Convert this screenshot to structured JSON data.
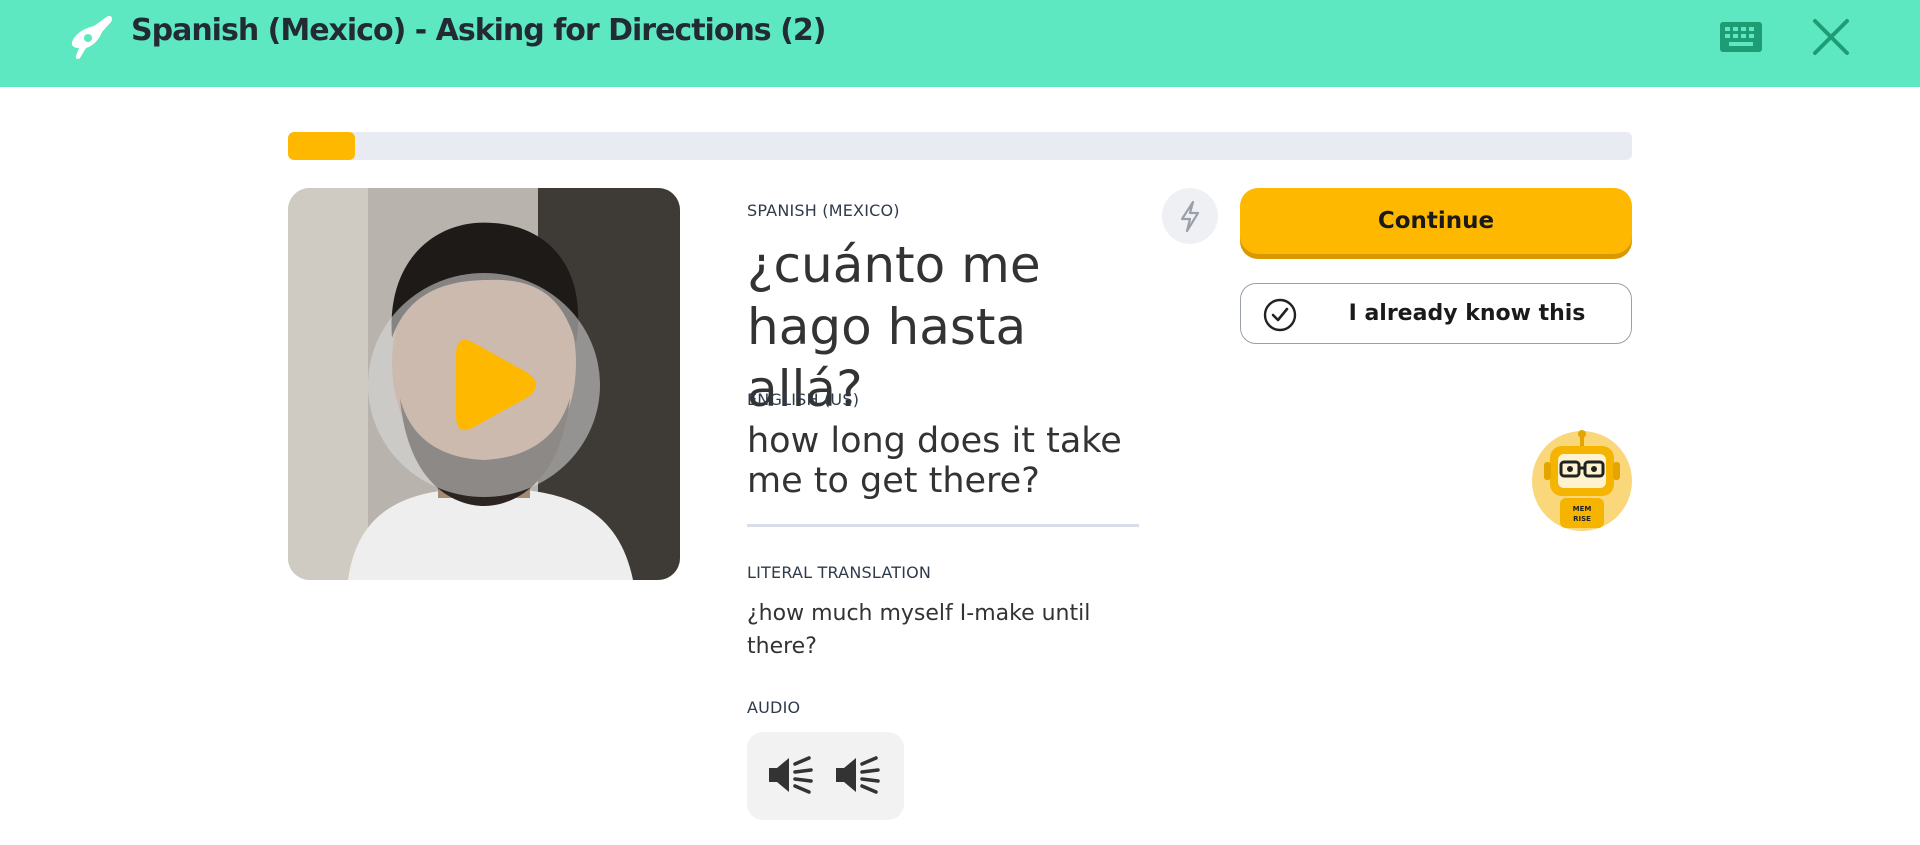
{
  "header": {
    "title": "Spanish (Mexico) - Asking for Directions (2)",
    "icons": [
      "memrise-logo-icon",
      "keyboard-icon",
      "close-icon"
    ],
    "background_color": "#5ee8c2"
  },
  "progress": {
    "value": 0.05,
    "fill_color": "#ffb800"
  },
  "video": {
    "play_icon": "play-icon",
    "accent_color": "#ffb800"
  },
  "card": {
    "source_language_label": "SPANISH (MEXICO)",
    "phrase_line1": "¿cuánto me",
    "phrase_line2": "hago hasta allá?",
    "target_language_label": "ENGLISH (US)",
    "translation_line1": "how long does it take",
    "translation_line2": "me to get there?",
    "literal_label": "LITERAL TRANSLATION",
    "literal_line1": "¿how much myself I-make until",
    "literal_line2": "there?",
    "audio_label": "AUDIO",
    "audio_icons": [
      "speaker-icon",
      "speaker-icon"
    ]
  },
  "actions": {
    "continue_label": "Continue",
    "know_label": "I already know this",
    "continue_color": "#ffb800"
  },
  "mascot": {
    "text": "MEM RISE",
    "icon": "robot-mascot-icon"
  }
}
